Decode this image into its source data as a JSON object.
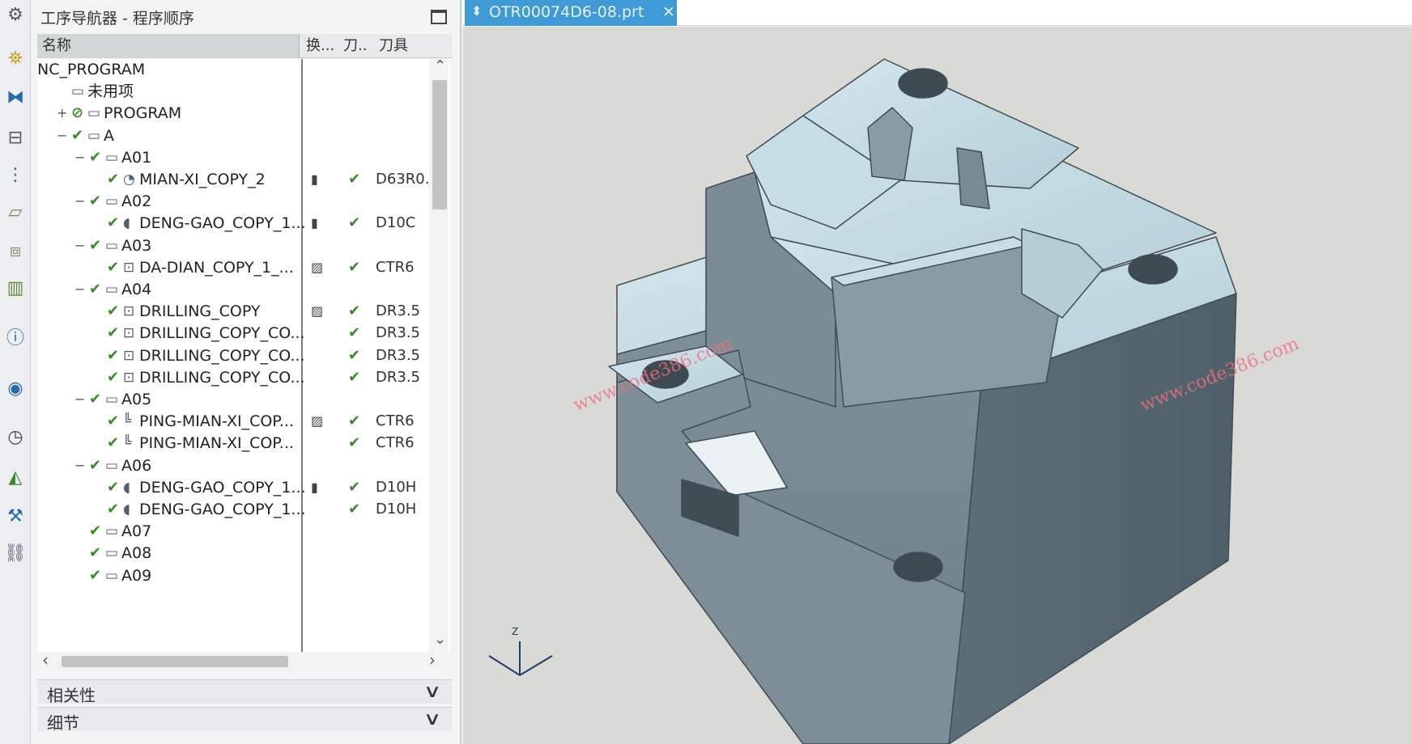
{
  "left_toolbar": {
    "icons": [
      "settings-icon",
      "machine-tool-view-icon",
      "geometry-view-icon",
      "method-view-icon",
      "program-order-view-icon",
      "part-icon",
      "assembly-icon",
      "library-icon",
      "info-icon",
      "web-icon",
      "history-icon",
      "color-icon",
      "tool-icon",
      "simulate-icon"
    ]
  },
  "navigator": {
    "title": "工序导航器 - 程序顺序",
    "columns": {
      "name": "名称",
      "switch": "换...",
      "toolpath": "刀..",
      "tool": "刀具"
    },
    "rows": [
      {
        "label": "NC_PROGRAM",
        "indent": 0,
        "expand": "",
        "check": "",
        "icon": "",
        "sw": "",
        "tm": "",
        "tool": ""
      },
      {
        "label": "未用项",
        "indent": 1,
        "expand": "",
        "check": "",
        "icon": "▭",
        "sw": "",
        "tm": "",
        "tool": ""
      },
      {
        "label": "PROGRAM",
        "indent": 1,
        "expand": "+",
        "check": "⊘",
        "icon": "▭",
        "sw": "",
        "tm": "",
        "tool": ""
      },
      {
        "label": "A",
        "indent": 1,
        "expand": "−",
        "check": "✔",
        "icon": "▭",
        "sw": "",
        "tm": "",
        "tool": ""
      },
      {
        "label": "A01",
        "indent": 2,
        "expand": "−",
        "check": "✔",
        "icon": "▭",
        "sw": "",
        "tm": "",
        "tool": ""
      },
      {
        "label": "MIAN-XI_COPY_2",
        "indent": 3,
        "expand": "",
        "check": "✔",
        "icon": "◔",
        "sw": "▮",
        "tm": "✔",
        "tool": "D63R0."
      },
      {
        "label": "A02",
        "indent": 2,
        "expand": "−",
        "check": "✔",
        "icon": "▭",
        "sw": "",
        "tm": "",
        "tool": ""
      },
      {
        "label": "DENG-GAO_COPY_1...",
        "indent": 3,
        "expand": "",
        "check": "✔",
        "icon": "◖",
        "sw": "▮",
        "tm": "✔",
        "tool": "D10C"
      },
      {
        "label": "A03",
        "indent": 2,
        "expand": "−",
        "check": "✔",
        "icon": "▭",
        "sw": "",
        "tm": "",
        "tool": ""
      },
      {
        "label": "DA-DIAN_COPY_1_...",
        "indent": 3,
        "expand": "",
        "check": "✔",
        "icon": "⊡",
        "sw": "▨",
        "tm": "✔",
        "tool": "CTR6"
      },
      {
        "label": "A04",
        "indent": 2,
        "expand": "−",
        "check": "✔",
        "icon": "▭",
        "sw": "",
        "tm": "",
        "tool": ""
      },
      {
        "label": "DRILLING_COPY",
        "indent": 3,
        "expand": "",
        "check": "✔",
        "icon": "⊡",
        "sw": "▨",
        "tm": "✔",
        "tool": "DR3.5"
      },
      {
        "label": "DRILLING_COPY_CO...",
        "indent": 3,
        "expand": "",
        "check": "✔",
        "icon": "⊡",
        "sw": "",
        "tm": "✔",
        "tool": "DR3.5"
      },
      {
        "label": "DRILLING_COPY_CO...",
        "indent": 3,
        "expand": "",
        "check": "✔",
        "icon": "⊡",
        "sw": "",
        "tm": "✔",
        "tool": "DR3.5"
      },
      {
        "label": "DRILLING_COPY_CO...",
        "indent": 3,
        "expand": "",
        "check": "✔",
        "icon": "⊡",
        "sw": "",
        "tm": "✔",
        "tool": "DR3.5"
      },
      {
        "label": "A05",
        "indent": 2,
        "expand": "−",
        "check": "✔",
        "icon": "▭",
        "sw": "",
        "tm": "",
        "tool": ""
      },
      {
        "label": "PING-MIAN-XI_COP...",
        "indent": 3,
        "expand": "",
        "check": "✔",
        "icon": "╚",
        "sw": "▨",
        "tm": "✔",
        "tool": "CTR6"
      },
      {
        "label": "PING-MIAN-XI_COP...",
        "indent": 3,
        "expand": "",
        "check": "✔",
        "icon": "╚",
        "sw": "",
        "tm": "✔",
        "tool": "CTR6"
      },
      {
        "label": "A06",
        "indent": 2,
        "expand": "−",
        "check": "✔",
        "icon": "▭",
        "sw": "",
        "tm": "",
        "tool": ""
      },
      {
        "label": "DENG-GAO_COPY_1...",
        "indent": 3,
        "expand": "",
        "check": "✔",
        "icon": "◖",
        "sw": "▮",
        "tm": "✔",
        "tool": "D10H"
      },
      {
        "label": "DENG-GAO_COPY_1...",
        "indent": 3,
        "expand": "",
        "check": "✔",
        "icon": "◖",
        "sw": "",
        "tm": "✔",
        "tool": "D10H"
      },
      {
        "label": "A07",
        "indent": 2,
        "expand": "",
        "check": "✔",
        "icon": "▭",
        "sw": "",
        "tm": "",
        "tool": ""
      },
      {
        "label": "A08",
        "indent": 2,
        "expand": "",
        "check": "✔",
        "icon": "▭",
        "sw": "",
        "tm": "",
        "tool": ""
      },
      {
        "label": "A09",
        "indent": 2,
        "expand": "",
        "check": "✔",
        "icon": "▭",
        "sw": "",
        "tm": "",
        "tool": ""
      }
    ],
    "panels": [
      {
        "label": "相关性",
        "chevron": "∨"
      },
      {
        "label": "细节",
        "chevron": "∨"
      }
    ]
  },
  "tab": {
    "label": "OTR00074D6-08.prt",
    "close": "×"
  },
  "viewport": {
    "watermark": "www.code386.com",
    "axis_label": "Z"
  }
}
